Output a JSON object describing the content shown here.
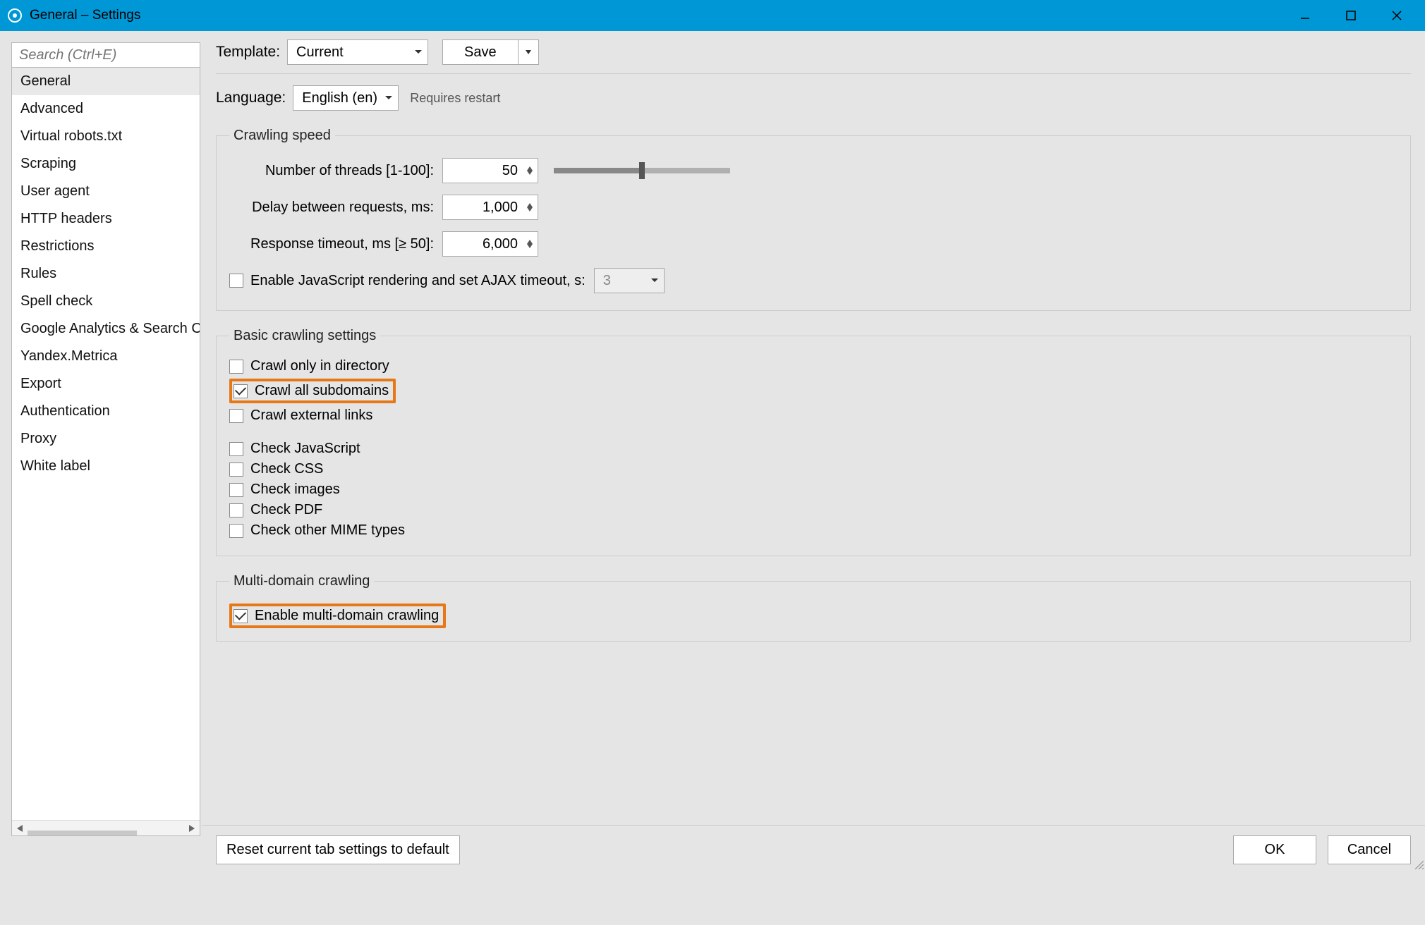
{
  "window": {
    "title": "General – Settings"
  },
  "search": {
    "placeholder": "Search (Ctrl+E)"
  },
  "sidebar": {
    "items": [
      "General",
      "Advanced",
      "Virtual robots.txt",
      "Scraping",
      "User agent",
      "HTTP headers",
      "Restrictions",
      "Rules",
      "Spell check",
      "Google Analytics & Search Console",
      "Yandex.Metrica",
      "Export",
      "Authentication",
      "Proxy",
      "White label"
    ],
    "selected_index": 0
  },
  "template_row": {
    "label": "Template:",
    "value": "Current",
    "save": "Save"
  },
  "language_row": {
    "label": "Language:",
    "value": "English (en)",
    "note": "Requires restart"
  },
  "crawling_speed": {
    "legend": "Crawling speed",
    "threads_label": "Number of threads [1-100]:",
    "threads": "50",
    "delay_label": "Delay between requests, ms:",
    "delay": "1,000",
    "timeout_label": "Response timeout, ms [≥ 50]:",
    "timeout": "6,000",
    "js_label": "Enable JavaScript rendering and set AJAX timeout, s:",
    "js_checked": false,
    "js_value": "3"
  },
  "basic": {
    "legend": "Basic crawling settings",
    "rows": [
      {
        "label": "Crawl only in directory",
        "checked": false,
        "hl": false
      },
      {
        "label": "Crawl all subdomains",
        "checked": true,
        "hl": true
      },
      {
        "label": "Crawl external links",
        "checked": false,
        "hl": false
      }
    ],
    "rows2": [
      {
        "label": "Check JavaScript",
        "checked": false
      },
      {
        "label": "Check CSS",
        "checked": false
      },
      {
        "label": "Check images",
        "checked": false
      },
      {
        "label": "Check PDF",
        "checked": false
      },
      {
        "label": "Check other MIME types",
        "checked": false
      }
    ]
  },
  "multi": {
    "legend": "Multi-domain crawling",
    "label": "Enable multi-domain crawling",
    "checked": true
  },
  "footer": {
    "reset": "Reset current tab settings to default",
    "ok": "OK",
    "cancel": "Cancel"
  }
}
